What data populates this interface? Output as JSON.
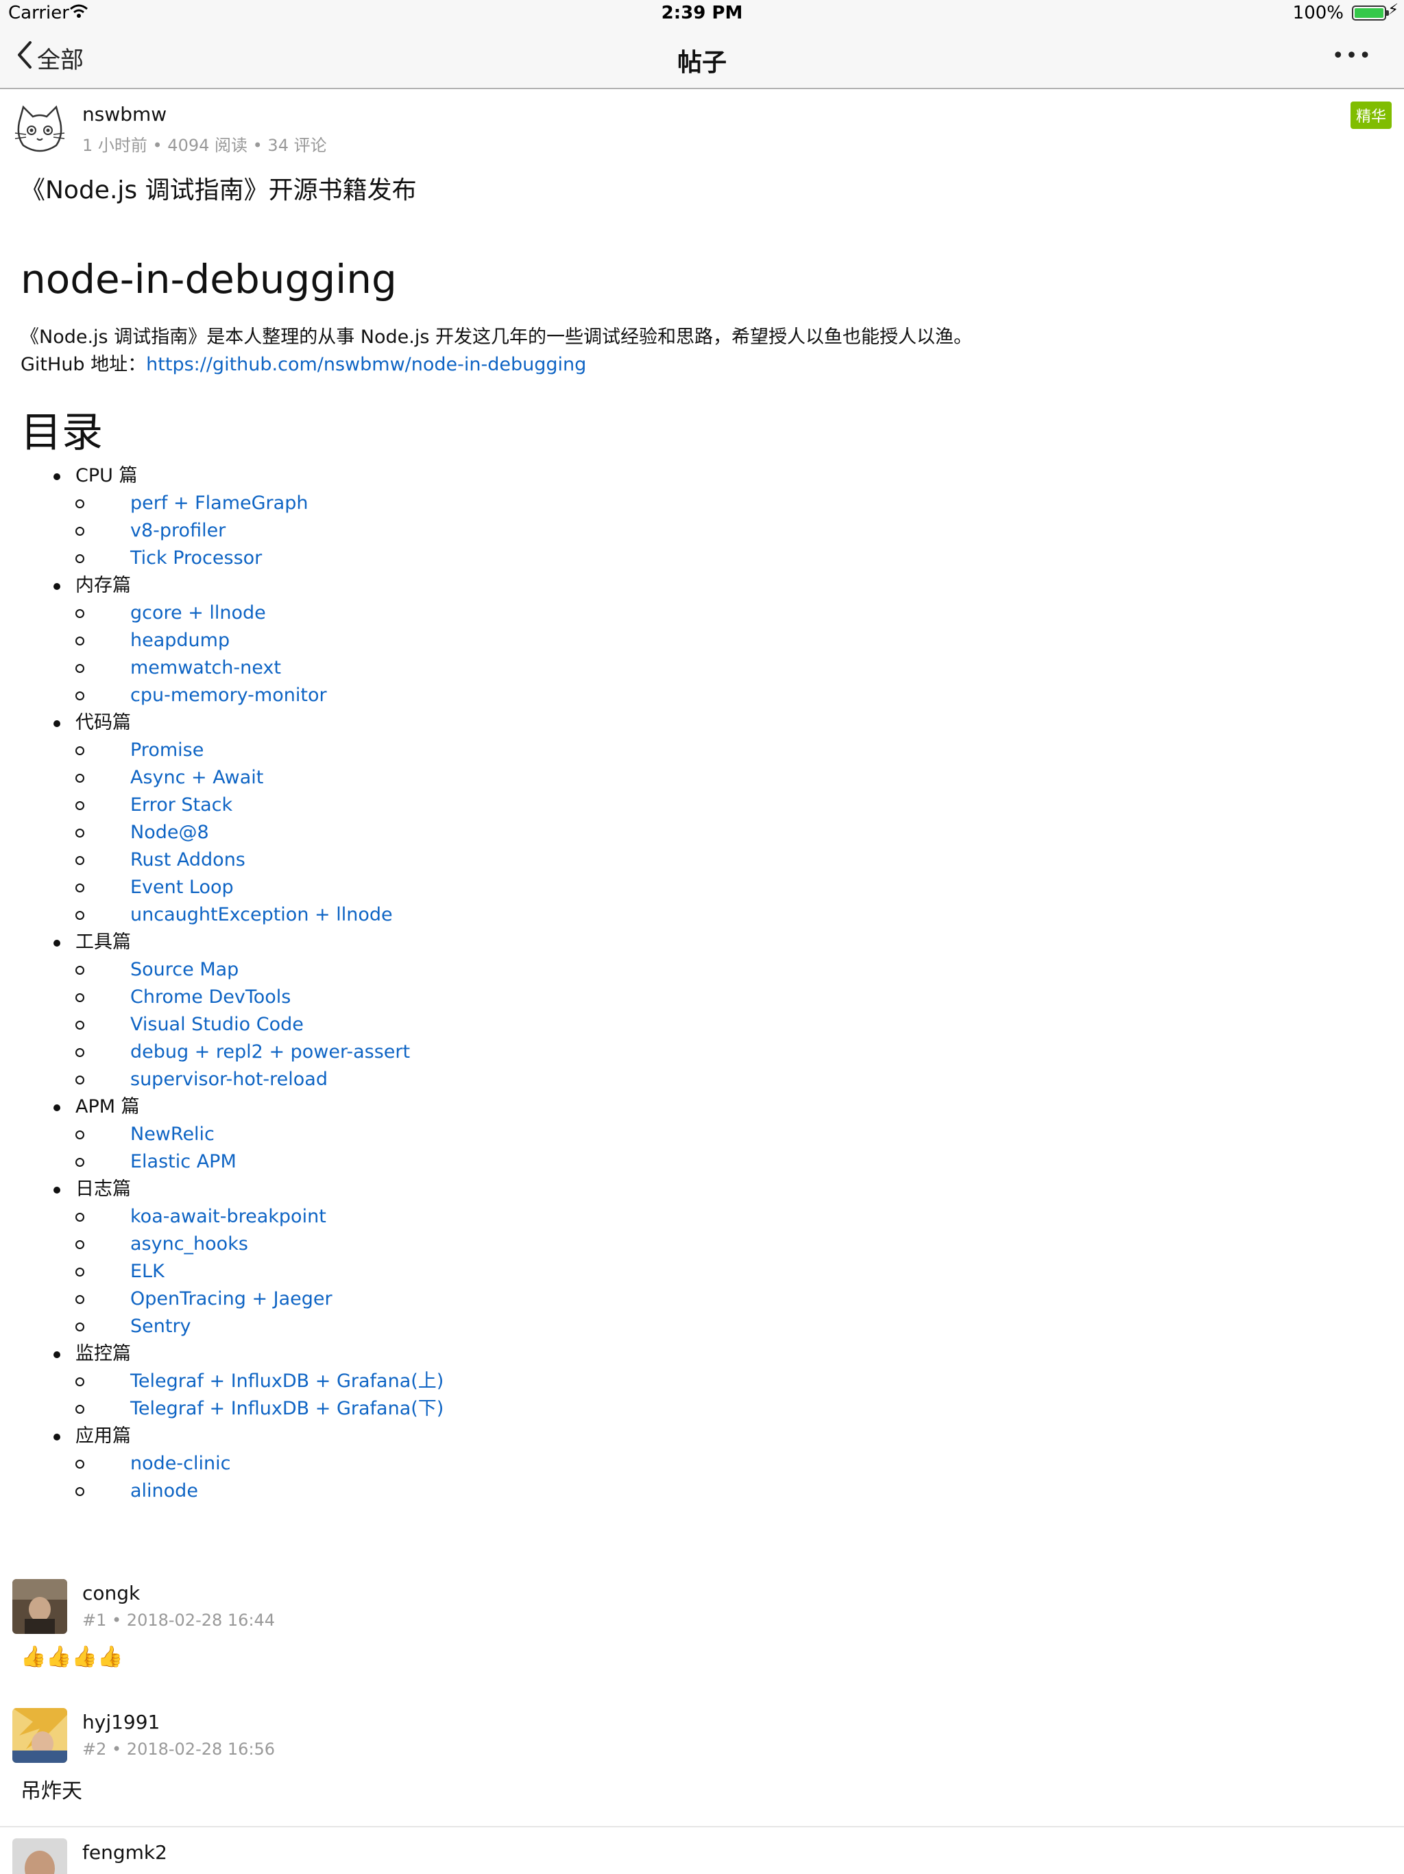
{
  "status_bar": {
    "carrier": "Carrier",
    "time": "2:39 PM",
    "battery": "100%"
  },
  "nav": {
    "back_label": "全部",
    "title": "帖子",
    "more_label": "•••"
  },
  "post": {
    "author": "nswbmw",
    "meta": "1 小时前 • 4094 阅读 • 34 评论",
    "badge": "精华",
    "title": "《Node.js 调试指南》开源书籍发布",
    "heading": "node-in-debugging",
    "intro": "《Node.js 调试指南》是本人整理的从事 Node.js 开发这几年的一些调试经验和思路，希望授人以鱼也能授人以渔。",
    "github_label": "GitHub 地址：",
    "github_url": "https://github.com/nswbmw/node-in-debugging",
    "toc_heading": "目录",
    "toc": [
      {
        "label": "CPU 篇",
        "items": [
          "perf + FlameGraph",
          "v8-profiler",
          "Tick Processor"
        ]
      },
      {
        "label": "内存篇",
        "items": [
          "gcore + llnode",
          "heapdump",
          "memwatch-next",
          "cpu-memory-monitor"
        ]
      },
      {
        "label": "代码篇",
        "items": [
          "Promise",
          "Async + Await",
          "Error Stack",
          "Node@8",
          "Rust Addons",
          "Event Loop",
          "uncaughtException + llnode"
        ]
      },
      {
        "label": "工具篇",
        "items": [
          "Source Map",
          "Chrome DevTools",
          "Visual Studio Code",
          "debug + repl2 + power-assert",
          "supervisor-hot-reload"
        ]
      },
      {
        "label": "APM 篇",
        "items": [
          "NewRelic",
          "Elastic APM"
        ]
      },
      {
        "label": "日志篇",
        "items": [
          "koa-await-breakpoint",
          "async_hooks",
          "ELK",
          "OpenTracing + Jaeger",
          "Sentry"
        ]
      },
      {
        "label": "监控篇",
        "items": [
          "Telegraf + InfluxDB + Grafana(上)",
          "Telegraf + InfluxDB + Grafana(下)"
        ]
      },
      {
        "label": "应用篇",
        "items": [
          "node-clinic",
          "alinode"
        ]
      }
    ]
  },
  "comments": [
    {
      "author": "congk",
      "meta": "#1 • 2018-02-28 16:44",
      "body": "👍👍👍👍"
    },
    {
      "author": "hyj1991",
      "meta": "#2 • 2018-02-28 16:56",
      "body": "吊炸天"
    },
    {
      "author": "fengmk2",
      "meta": "",
      "body": ""
    }
  ],
  "colors": {
    "link": "#0e64c4",
    "badge": "#80bd01",
    "meta": "#999999"
  }
}
